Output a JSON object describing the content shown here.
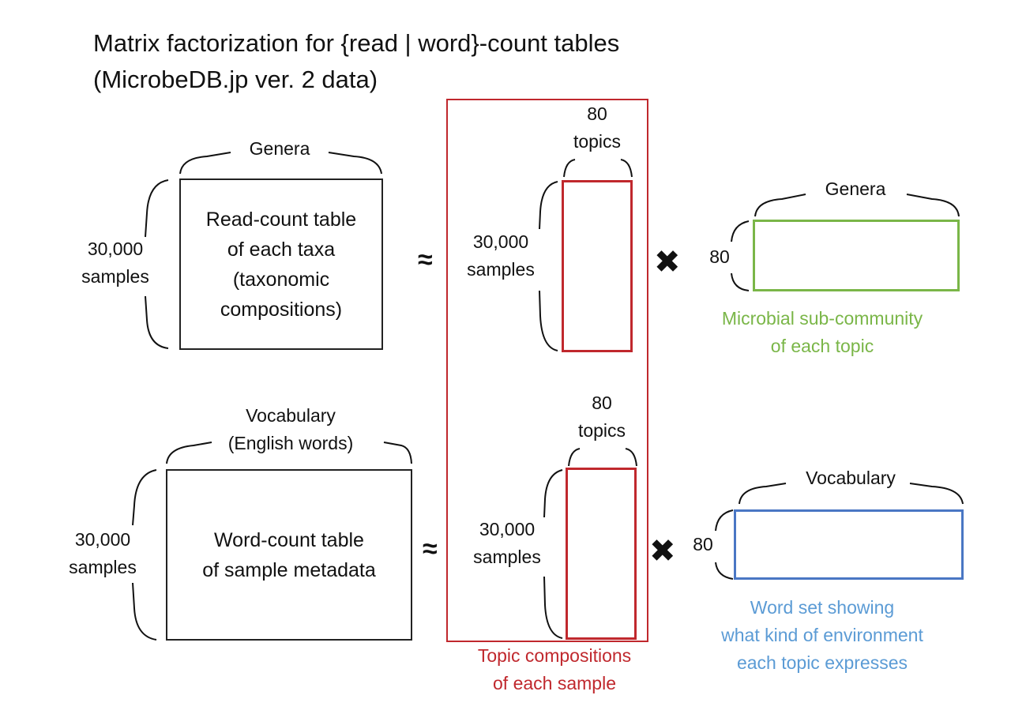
{
  "title": {
    "line1": "Matrix factorization for {read | word}-count tables",
    "line2": "(MicrobeDB.jp ver. 2 data)"
  },
  "colors": {
    "black": "#111111",
    "topic_red": "#c0282d",
    "microbial_green": "#7ab648",
    "word_blue": "#4a77c4",
    "word_text_blue": "#5b9bd5"
  },
  "top_row": {
    "genera_label": "Genera",
    "samples_label_line1": "30,000",
    "samples_label_line2": "samples",
    "table_text": [
      "Read-count table",
      "of each taxa",
      "(taxonomic",
      "compositions)"
    ],
    "approx_symbol": "≈",
    "topics_label_line1": "80",
    "topics_label_line2": "topics",
    "mid_samples_line1": "30,000",
    "mid_samples_line2": "samples",
    "times_symbol": "✖",
    "rows_label": "80",
    "right_genera_label": "Genera",
    "right_caption": [
      "Microbial sub-community",
      "of each topic"
    ]
  },
  "bottom_row": {
    "vocab_label_line1": "Vocabulary",
    "vocab_label_line2": "(English words)",
    "samples_label_line1": "30,000",
    "samples_label_line2": "samples",
    "table_text": [
      "Word-count table",
      "of sample metadata"
    ],
    "approx_symbol": "≈",
    "topics_label_line1": "80",
    "topics_label_line2": "topics",
    "mid_samples_line1": "30,000",
    "mid_samples_line2": "samples",
    "times_symbol": "✖",
    "rows_label": "80",
    "right_vocab_label": "Vocabulary",
    "right_caption": [
      "Word set showing",
      "what kind of environment",
      "each topic expresses"
    ]
  },
  "topic_caption": [
    "Topic compositions",
    "of each sample"
  ]
}
